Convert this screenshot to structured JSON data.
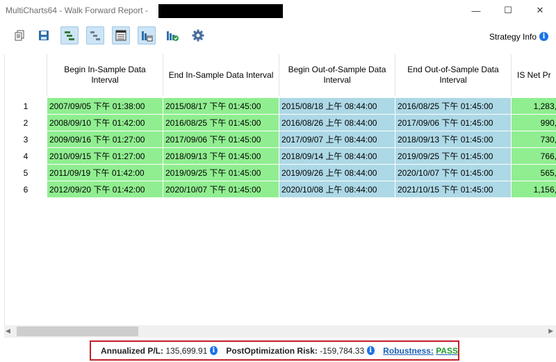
{
  "window": {
    "title": "MultiCharts64 - Walk Forward Report - ",
    "controls": {
      "minimize": "—",
      "maximize": "☐",
      "close": "✕"
    }
  },
  "toolbar": {
    "icons": [
      "copy-icon",
      "save-icon",
      "gantt-active-icon",
      "gantt-icon",
      "table-icon",
      "chart-calendar-icon",
      "chart-check-icon",
      "settings-icon"
    ],
    "strategy_info_label": "Strategy Info",
    "info_glyph": "i"
  },
  "table": {
    "columns": [
      "Begin In-Sample Data Interval",
      "End In-Sample Data Interval",
      "Begin Out-of-Sample Data Interval",
      "End Out-of-Sample Data Interval",
      "IS Net Pr"
    ],
    "rows": [
      {
        "num": "1",
        "begin_is": "2007/09/05 下午 01:38:00",
        "end_is": "2015/08/17 下午 01:45:00",
        "begin_oos": "2015/08/18 上午 08:44:00",
        "end_oos": "2016/08/25 下午 01:45:00",
        "is_net": "1,283,"
      },
      {
        "num": "2",
        "begin_is": "2008/09/10 下午 01:42:00",
        "end_is": "2016/08/25 下午 01:45:00",
        "begin_oos": "2016/08/26 上午 08:44:00",
        "end_oos": "2017/09/06 下午 01:45:00",
        "is_net": "990,"
      },
      {
        "num": "3",
        "begin_is": "2009/09/16 下午 01:27:00",
        "end_is": "2017/09/06 下午 01:45:00",
        "begin_oos": "2017/09/07 上午 08:44:00",
        "end_oos": "2018/09/13 下午 01:45:00",
        "is_net": "730,"
      },
      {
        "num": "4",
        "begin_is": "2010/09/15 下午 01:27:00",
        "end_is": "2018/09/13 下午 01:45:00",
        "begin_oos": "2018/09/14 上午 08:44:00",
        "end_oos": "2019/09/25 下午 01:45:00",
        "is_net": "766,"
      },
      {
        "num": "5",
        "begin_is": "2011/09/19 下午 01:42:00",
        "end_is": "2019/09/25 下午 01:45:00",
        "begin_oos": "2019/09/26 上午 08:44:00",
        "end_oos": "2020/10/07 下午 01:45:00",
        "is_net": "565,"
      },
      {
        "num": "6",
        "begin_is": "2012/09/20 下午 01:42:00",
        "end_is": "2020/10/07 下午 01:45:00",
        "begin_oos": "2020/10/08 上午 08:44:00",
        "end_oos": "2021/10/15 下午 01:45:00",
        "is_net": "1,156,"
      }
    ]
  },
  "scrollbar": {
    "left_arrow": "◀",
    "right_arrow": "▶"
  },
  "summary": {
    "annualized_label": "Annualized P/L:",
    "annualized_value": "135,699.91",
    "risk_label": "PostOptimization Risk:",
    "risk_value": "-159,784.33",
    "robustness_label": "Robustness:",
    "robustness_value": "PASS"
  },
  "colors": {
    "in_sample": "#90ee90",
    "out_of_sample": "#add8e6",
    "toolbar_active": "#cde4f5",
    "highlight_border": "#c0202a",
    "info_icon": "#1a73e8",
    "pass_text": "#1e9e2e"
  }
}
